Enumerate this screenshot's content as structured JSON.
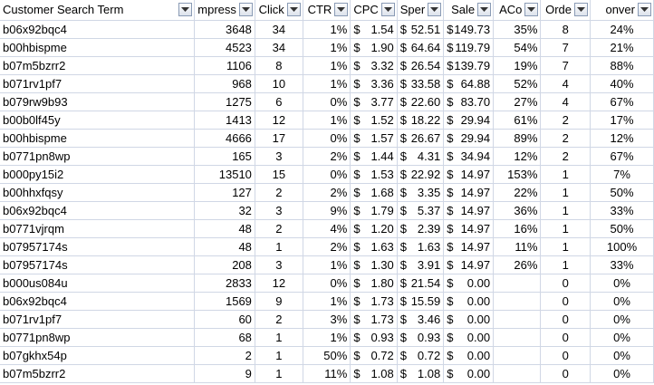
{
  "columns": [
    "Customer Search Term",
    "Impressions",
    "Clicks",
    "CTR",
    "CPC",
    "Spend",
    "Sales",
    "ACoS",
    "Orders",
    "Conversion"
  ],
  "column_display": [
    "Customer Search Term",
    "mpress",
    "Click",
    "CTR",
    "CPC",
    "Sper",
    "Sale",
    "ACo",
    "Orde",
    "onver"
  ],
  "currency_symbol": "$",
  "rows": [
    [
      "b06x92bqc4",
      "3648",
      "34",
      "1%",
      "1.54",
      "52.51",
      "149.73",
      "35%",
      "8",
      "24%"
    ],
    [
      "b00hbispme",
      "4523",
      "34",
      "1%",
      "1.90",
      "64.64",
      "119.79",
      "54%",
      "7",
      "21%"
    ],
    [
      "b07m5bzrr2",
      "1106",
      "8",
      "1%",
      "3.32",
      "26.54",
      "139.79",
      "19%",
      "7",
      "88%"
    ],
    [
      "b071rv1pf7",
      "968",
      "10",
      "1%",
      "3.36",
      "33.58",
      "64.88",
      "52%",
      "4",
      "40%"
    ],
    [
      "b079rw9b93",
      "1275",
      "6",
      "0%",
      "3.77",
      "22.60",
      "83.70",
      "27%",
      "4",
      "67%"
    ],
    [
      "b00b0lf45y",
      "1413",
      "12",
      "1%",
      "1.52",
      "18.22",
      "29.94",
      "61%",
      "2",
      "17%"
    ],
    [
      "b00hbispme",
      "4666",
      "17",
      "0%",
      "1.57",
      "26.67",
      "29.94",
      "89%",
      "2",
      "12%"
    ],
    [
      "b0771pn8wp",
      "165",
      "3",
      "2%",
      "1.44",
      "4.31",
      "34.94",
      "12%",
      "2",
      "67%"
    ],
    [
      "b000py15i2",
      "13510",
      "15",
      "0%",
      "1.53",
      "22.92",
      "14.97",
      "153%",
      "1",
      "7%"
    ],
    [
      "b00hhxfqsy",
      "127",
      "2",
      "2%",
      "1.68",
      "3.35",
      "14.97",
      "22%",
      "1",
      "50%"
    ],
    [
      "b06x92bqc4",
      "32",
      "3",
      "9%",
      "1.79",
      "5.37",
      "14.97",
      "36%",
      "1",
      "33%"
    ],
    [
      "b0771vjrqm",
      "48",
      "2",
      "4%",
      "1.20",
      "2.39",
      "14.97",
      "16%",
      "1",
      "50%"
    ],
    [
      "b07957174s",
      "48",
      "1",
      "2%",
      "1.63",
      "1.63",
      "14.97",
      "11%",
      "1",
      "100%"
    ],
    [
      "b07957174s",
      "208",
      "3",
      "1%",
      "1.30",
      "3.91",
      "14.97",
      "26%",
      "1",
      "33%"
    ],
    [
      "b000us084u",
      "2833",
      "12",
      "0%",
      "1.80",
      "21.54",
      "0.00",
      "",
      "0",
      "0%"
    ],
    [
      "b06x92bqc4",
      "1569",
      "9",
      "1%",
      "1.73",
      "15.59",
      "0.00",
      "",
      "0",
      "0%"
    ],
    [
      "b071rv1pf7",
      "60",
      "2",
      "3%",
      "1.73",
      "3.46",
      "0.00",
      "",
      "0",
      "0%"
    ],
    [
      "b0771pn8wp",
      "68",
      "1",
      "1%",
      "0.93",
      "0.93",
      "0.00",
      "",
      "0",
      "0%"
    ],
    [
      "b07gkhx54p",
      "2",
      "1",
      "50%",
      "0.72",
      "0.72",
      "0.00",
      "",
      "0",
      "0%"
    ],
    [
      "b07m5bzrr2",
      "9",
      "1",
      "11%",
      "1.08",
      "1.08",
      "0.00",
      "",
      "0",
      "0%"
    ]
  ],
  "icons": {
    "filter": "dropdown-filter-icon"
  },
  "colors": {
    "gridline": "#d0d7e5",
    "filter_border": "#8a9bb5"
  }
}
